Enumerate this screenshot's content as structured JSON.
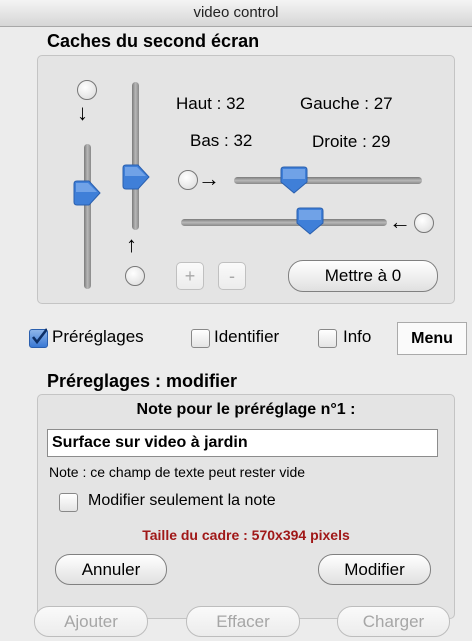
{
  "window": {
    "title": "video control"
  },
  "masks": {
    "section_title": "Caches du second écran",
    "haut": "Haut : 32",
    "gauche": "Gauche : 27",
    "bas": "Bas : 32",
    "droite": "Droite : 29",
    "plus_label": "+",
    "minus_label": "-",
    "reset_label": "Mettre à 0"
  },
  "options": {
    "presets_label": "Préréglages",
    "presets_checked": true,
    "identify_label": "Identifier",
    "identify_checked": false,
    "info_label": "Info",
    "info_checked": false,
    "menu_label": "Menu"
  },
  "preset_edit": {
    "section_title": "Préreglages : modifier",
    "note_title": "Note pour le préréglage n°1 :",
    "note_value": "Surface sur video à jardin",
    "note_hint": "Note : ce champ de texte peut rester vide",
    "only_note_label": "Modifier seulement la note",
    "only_note_checked": false,
    "frame_size": "Taille du cadre : 570x394 pixels",
    "cancel_label": "Annuler",
    "modify_label": "Modifier"
  },
  "bottom": {
    "add_label": "Ajouter",
    "erase_label": "Effacer",
    "load_label": "Charger"
  },
  "colors": {
    "accent_blue": "#3f7fd8",
    "frame_size_red": "#a01818"
  }
}
